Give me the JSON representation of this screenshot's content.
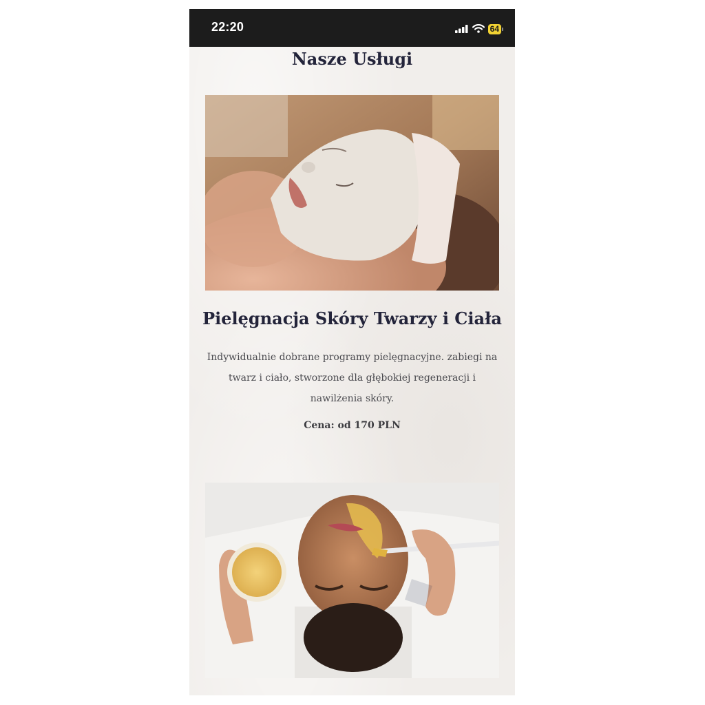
{
  "status_bar": {
    "time": "22:20",
    "battery": "64",
    "icons": [
      "signal-icon",
      "wifi-icon",
      "battery-icon"
    ]
  },
  "page": {
    "title": "Nasze Usługi"
  },
  "services": [
    {
      "image": "facial-clay-mask-photo",
      "title": "Pielęgnacja Skóry Twarzy i Ciała",
      "description": "Indywidualnie dobrane programy pielęgnacyjne. zabiegi na twarz i  ciało, stworzone dla głębokiej regeneracji i nawilżenia skóry.",
      "price": "Cena: od 170 PLN"
    },
    {
      "image": "golden-mask-application-photo"
    }
  ],
  "colors": {
    "status_bar_bg": "#1c1c1c",
    "page_bg": "#f1eeeb",
    "heading": "#23243a",
    "body_text": "#4a4a4f",
    "battery": "#f2d233"
  }
}
